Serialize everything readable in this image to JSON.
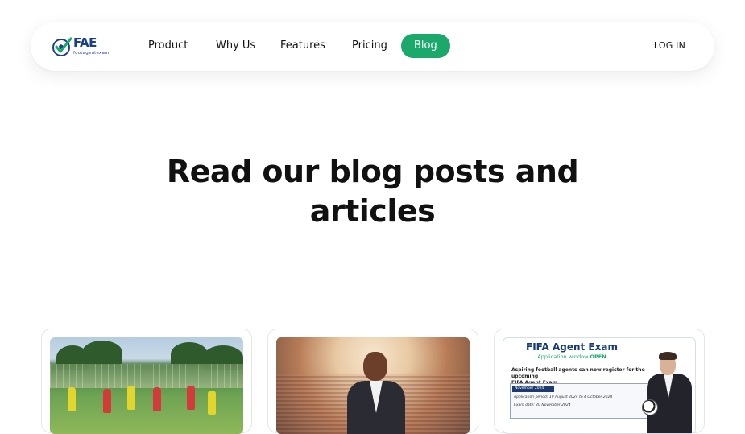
{
  "brand": {
    "logo_text": "FAE",
    "logo_subtext": "footagentexam",
    "colors": {
      "primary_blue": "#1c3f8a",
      "accent_green": "#1aa96b"
    }
  },
  "nav": {
    "items": [
      {
        "label": "Product",
        "active": false
      },
      {
        "label": "Why Us",
        "active": false
      },
      {
        "label": "Features",
        "active": false
      },
      {
        "label": "Pricing",
        "active": false
      },
      {
        "label": "Blog",
        "active": true
      }
    ],
    "login_label": "LOG IN"
  },
  "hero": {
    "headline_line1": "Read our blog posts and",
    "headline_line2": "articles"
  },
  "cards": [
    {
      "image": "youth-football-match"
    },
    {
      "image": "football-agent-in-stadium"
    },
    {
      "image": "fifa-agent-exam-poster",
      "poster": {
        "title": "FIFA Agent Exam",
        "subtitle_prefix": "Application window",
        "subtitle_status": "OPEN",
        "body_line1": "Aspiring football agents can now register for the upcoming",
        "body_line2": "FIFA Agent Exam.",
        "box_header": "November 2024",
        "line1": "Application period: 19 August 2024 to 4 October 2024",
        "line2": "Exam date: 20 November 2024"
      }
    }
  ]
}
